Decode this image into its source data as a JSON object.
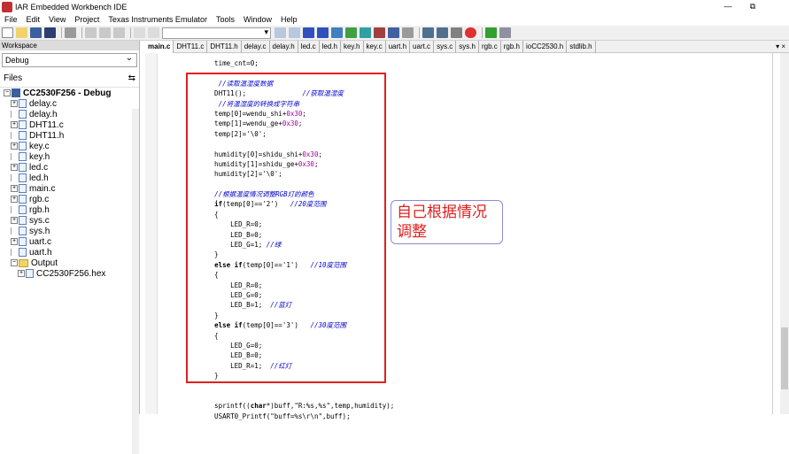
{
  "window": {
    "title": "IAR Embedded Workbench IDE",
    "minimize": "—",
    "restore": "⧉"
  },
  "menu": [
    "File",
    "Edit",
    "View",
    "Project",
    "Texas Instruments Emulator",
    "Tools",
    "Window",
    "Help"
  ],
  "workspace": {
    "title": "Workspace",
    "config": "Debug",
    "files_label": "Files",
    "tree": [
      {
        "label": "CC2530F256 - Debug",
        "kind": "project",
        "level": 0,
        "bold": true
      },
      {
        "label": "delay.c",
        "kind": "file",
        "level": 1,
        "expander": "+"
      },
      {
        "label": "delay.h",
        "kind": "file",
        "level": 1,
        "expander": ""
      },
      {
        "label": "DHT11.c",
        "kind": "file",
        "level": 1,
        "expander": "+"
      },
      {
        "label": "DHT11.h",
        "kind": "file",
        "level": 1,
        "expander": ""
      },
      {
        "label": "key.c",
        "kind": "file",
        "level": 1,
        "expander": "+"
      },
      {
        "label": "key.h",
        "kind": "file",
        "level": 1,
        "expander": ""
      },
      {
        "label": "led.c",
        "kind": "file",
        "level": 1,
        "expander": "+"
      },
      {
        "label": "led.h",
        "kind": "file",
        "level": 1,
        "expander": ""
      },
      {
        "label": "main.c",
        "kind": "file",
        "level": 1,
        "expander": "+"
      },
      {
        "label": "rgb.c",
        "kind": "file",
        "level": 1,
        "expander": "+"
      },
      {
        "label": "rgb.h",
        "kind": "file",
        "level": 1,
        "expander": ""
      },
      {
        "label": "sys.c",
        "kind": "file",
        "level": 1,
        "expander": "+"
      },
      {
        "label": "sys.h",
        "kind": "file",
        "level": 1,
        "expander": ""
      },
      {
        "label": "uart.c",
        "kind": "file",
        "level": 1,
        "expander": "+"
      },
      {
        "label": "uart.h",
        "kind": "file",
        "level": 1,
        "expander": ""
      },
      {
        "label": "Output",
        "kind": "folder",
        "level": 1,
        "expander": "−"
      },
      {
        "label": "CC2530F256.hex",
        "kind": "file",
        "level": 2,
        "expander": "+"
      }
    ]
  },
  "tabs": [
    "main.c",
    "DHT11.c",
    "DHT11.h",
    "delay.c",
    "delay.h",
    "led.c",
    "led.h",
    "key.h",
    "key.c",
    "uart.h",
    "uart.c",
    "sys.c",
    "sys.h",
    "rgb.c",
    "rgb.h",
    "ioCC2530.h",
    "stdlib.h"
  ],
  "active_tab": "main.c",
  "tab_controls": "▾ ×",
  "note": "自己根据情况调整",
  "code_lines": [
    "    time_cnt=0;",
    "",
    "     //读取温湿度数据",
    "    DHT11();              //获取温湿度",
    "     //将温湿度的转换成字符串",
    "    temp[0]=wendu_shi+0x30;",
    "    temp[1]=wendu_ge+0x30;",
    "    temp[2]='\\0';",
    "",
    "    humidity[0]=shidu_shi+0x30;",
    "    humidity[1]=shidu_ge+0x30;",
    "    humidity[2]='\\0';",
    "",
    "    //根据温度情况调整RGB灯的颜色",
    "    if(temp[0]=='2')   //20度范围",
    "    {",
    "        LED_R=0;",
    "        LED_B=0;",
    "        LED_G=1; //绿",
    "    }",
    "    else if(temp[0]=='1')   //10度范围",
    "    {",
    "        LED_R=0;",
    "        LED_G=0;",
    "        LED_B=1;  //蓝灯",
    "    }",
    "    else if(temp[0]=='3')   //30度范围",
    "    {",
    "        LED_G=0;",
    "        LED_B=0;",
    "        LED_R=1;  //红灯",
    "    }",
    "",
    "",
    "    sprintf((char*)buff,\"R:%s,%s\",temp,humidity);",
    "    USART0_Printf(\"buff=%s\\r\\n\",buff);"
  ],
  "colors": {
    "accent_red": "#e02020",
    "comment_blue": "#0000c8",
    "number_purple": "#a000a0"
  }
}
